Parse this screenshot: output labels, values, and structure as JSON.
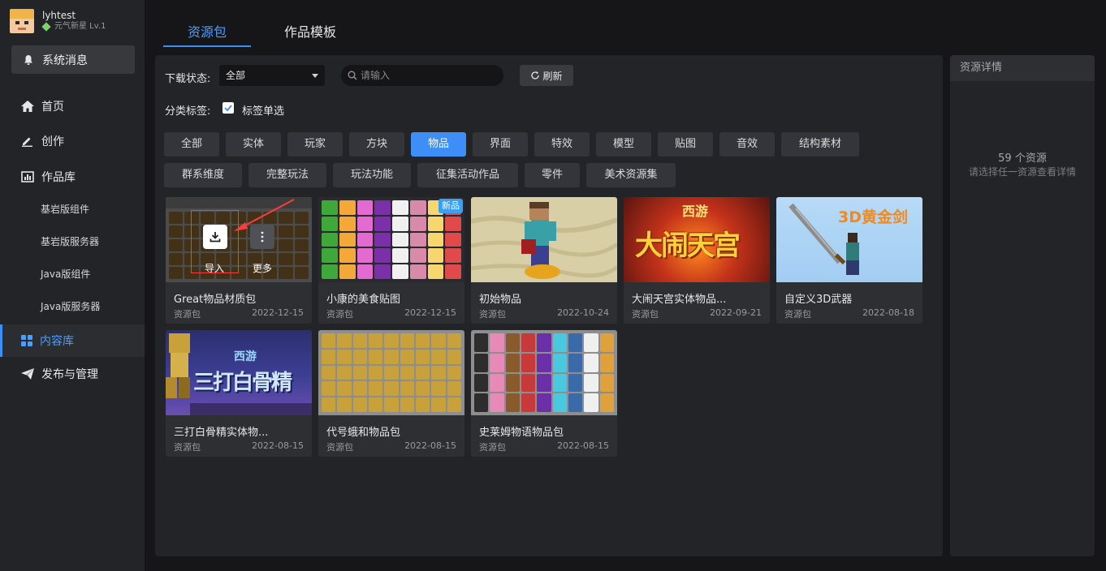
{
  "user": {
    "name": "lyhtest",
    "level": "元气新星 Lv.1"
  },
  "sidebar": {
    "system_messages": "系统消息",
    "items": [
      {
        "label": "首页"
      },
      {
        "label": "创作"
      },
      {
        "label": "作品库"
      },
      {
        "label": "基岩版组件"
      },
      {
        "label": "基岩版服务器"
      },
      {
        "label": "Java版组件"
      },
      {
        "label": "Java版服务器"
      },
      {
        "label": "内容库"
      },
      {
        "label": "发布与管理"
      }
    ]
  },
  "tabs": [
    {
      "label": "资源包"
    },
    {
      "label": "作品模板"
    }
  ],
  "filters": {
    "download_status_label": "下载状态:",
    "download_status_value": "全部",
    "search_placeholder": "请输入",
    "refresh_label": "刷新",
    "category_label": "分类标签:",
    "single_select_label": "标签单选"
  },
  "categories": [
    "全部",
    "实体",
    "玩家",
    "方块",
    "物品",
    "界面",
    "特效",
    "模型",
    "贴图",
    "音效",
    "结构素材",
    "群系维度",
    "完整玩法",
    "玩法功能",
    "征集活动作品",
    "零件",
    "美术资源集"
  ],
  "active_category": "物品",
  "cards": [
    {
      "title": "Great物品材质包",
      "type": "资源包",
      "date": "2022-12-15"
    },
    {
      "title": "小康的美食贴图",
      "type": "资源包",
      "date": "2022-12-15",
      "badge": "新品"
    },
    {
      "title": "初始物品",
      "type": "资源包",
      "date": "2022-10-24"
    },
    {
      "title": "大闹天宫实体物品...",
      "type": "资源包",
      "date": "2022-09-21",
      "thumb_text_top": "西游",
      "thumb_text": "大闹天宫"
    },
    {
      "title": "自定义3D武器",
      "type": "资源包",
      "date": "2022-08-18",
      "thumb_text": "3D黄金剑"
    },
    {
      "title": "三打白骨精实体物...",
      "type": "资源包",
      "date": "2022-08-15",
      "thumb_text_top": "西游",
      "thumb_text": "三打白骨精"
    },
    {
      "title": "代号蛾和物品包",
      "type": "资源包",
      "date": "2022-08-15"
    },
    {
      "title": "史莱姆物语物品包",
      "type": "资源包",
      "date": "2022-08-15"
    }
  ],
  "hover_actions": {
    "import": "导入",
    "more": "更多"
  },
  "details": {
    "title": "资源详情",
    "count": "59 个资源",
    "hint": "请选择任一资源查看详情"
  },
  "colors": {
    "accent": "#3d8ef7",
    "panel": "#232427",
    "card": "#2e2f33"
  }
}
